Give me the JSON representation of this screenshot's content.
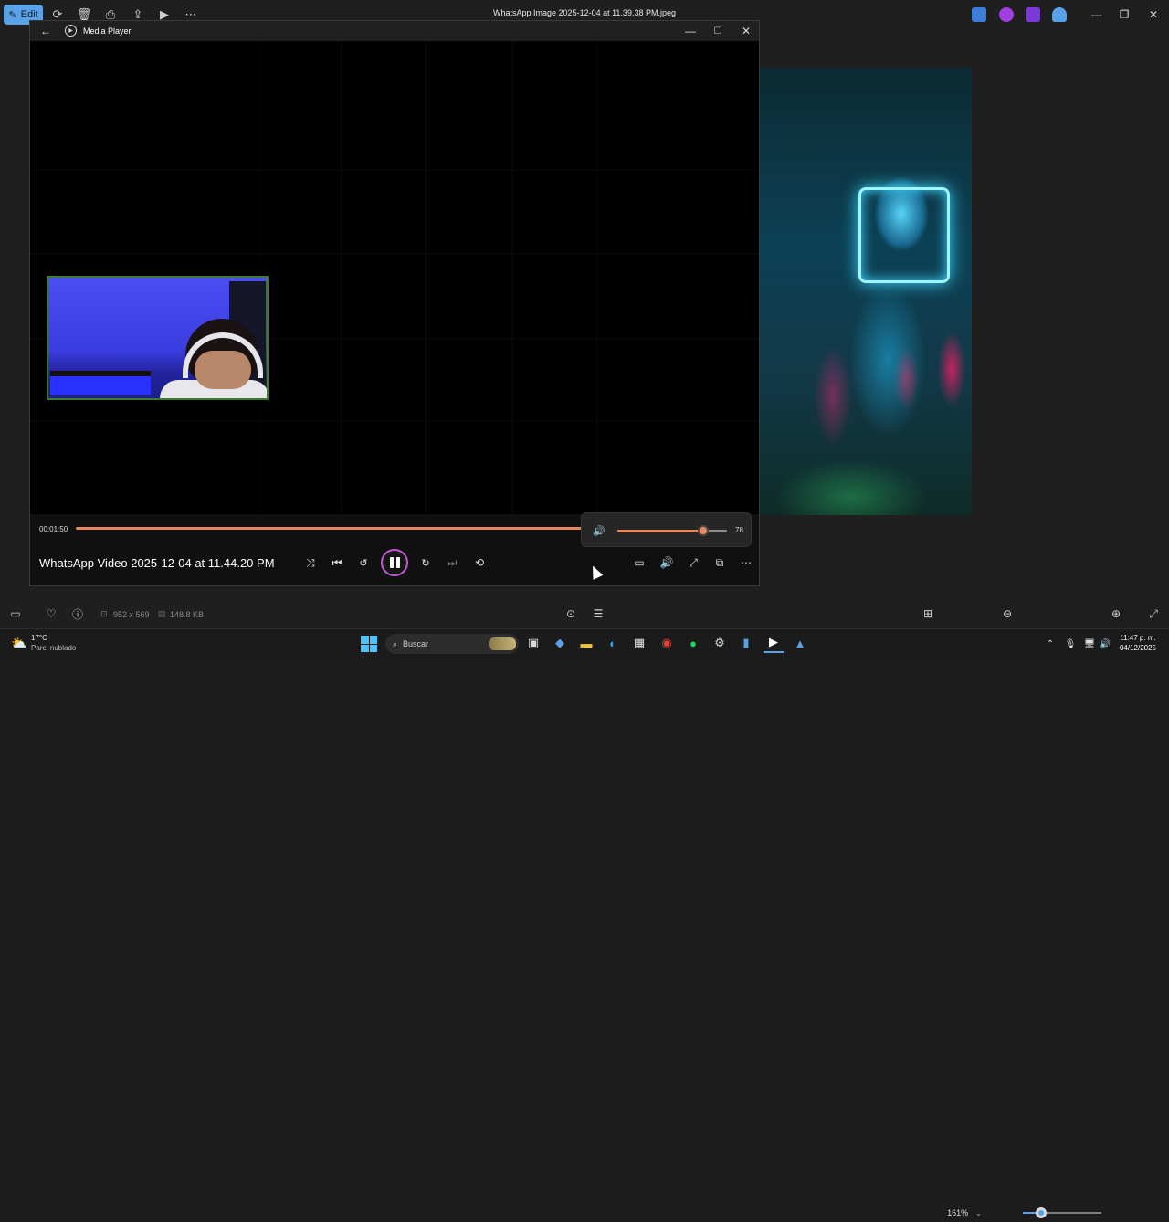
{
  "photos": {
    "toolbar": {
      "edit_label": "Edit",
      "icons": [
        "rotate-icon",
        "delete-icon",
        "print-icon",
        "share-icon",
        "slideshow-icon",
        "more-icon"
      ]
    },
    "window_title": "WhatsApp Image 2025-12-04 at 11.39.38 PM.jpeg",
    "statusbar": {
      "dimensions": "952 x 569",
      "file_size": "148.8 KB",
      "zoom": "161%",
      "zoom_fraction": 0.23
    }
  },
  "media_player": {
    "app_title": "Media Player",
    "elapsed": "00:01:50",
    "video_title": "WhatsApp Video 2025-12-04 at 11.44.20 PM",
    "progress_fraction": 1.0,
    "volume": {
      "value": "78",
      "fraction": 0.78
    },
    "colors": {
      "accent": "#e8865d",
      "play_ring": "#c25bd3"
    }
  },
  "taskbar": {
    "weather_temp": "17°C",
    "weather_desc": "Parc. nublado",
    "search_placeholder": "Buscar",
    "time": "11:47 p. m.",
    "date": "04/12/2025"
  }
}
